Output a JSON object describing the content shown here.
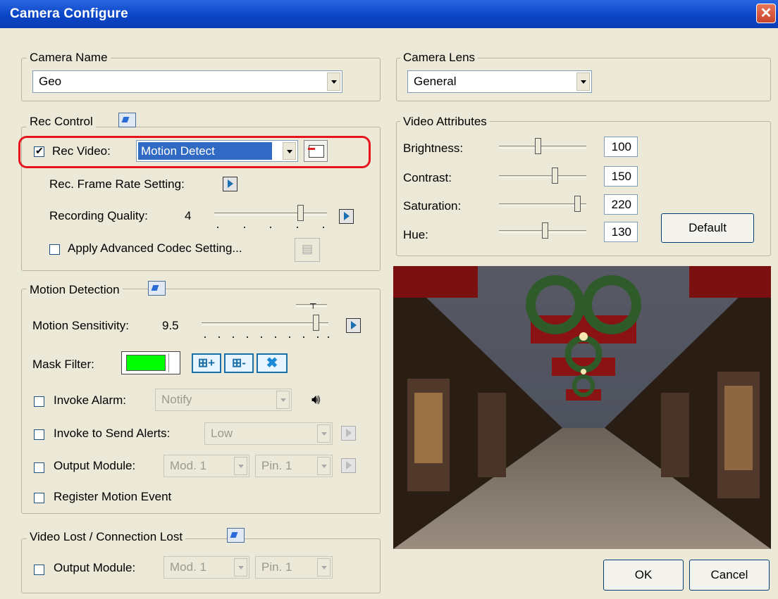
{
  "window": {
    "title": "Camera Configure"
  },
  "camera_name": {
    "legend": "Camera Name",
    "value": "Geo"
  },
  "camera_lens": {
    "legend": "Camera Lens",
    "value": "General"
  },
  "rec_control": {
    "legend": "Rec Control",
    "rec_video_label": "Rec Video:",
    "rec_video_checked": true,
    "rec_video_value": "Motion Detect",
    "frame_rate_label": "Rec. Frame Rate Setting:",
    "quality_label": "Recording Quality:",
    "quality_value": "4",
    "advanced_codec_label": "Apply Advanced Codec Setting..."
  },
  "video_attributes": {
    "legend": "Video Attributes",
    "rows": [
      {
        "label": "Brightness:",
        "value": "100"
      },
      {
        "label": "Contrast:",
        "value": "150"
      },
      {
        "label": "Saturation:",
        "value": "220"
      },
      {
        "label": "Hue:",
        "value": "130"
      }
    ],
    "default_label": "Default"
  },
  "motion_detection": {
    "legend": "Motion Detection",
    "sensitivity_label": "Motion Sensitivity:",
    "sensitivity_value": "9.5",
    "mask_filter_label": "Mask Filter:",
    "mask_color": "#00ff00",
    "invoke_alarm_label": "Invoke Alarm:",
    "invoke_alarm_value": "Notify",
    "send_alerts_label": "Invoke to Send Alerts:",
    "send_alerts_value": "Low",
    "output_module_label": "Output Module:",
    "module_value": "Mod. 1",
    "pin_value": "Pin. 1",
    "register_label": "Register Motion Event"
  },
  "video_lost": {
    "legend": "Video Lost / Connection Lost",
    "output_module_label": "Output Module:",
    "module_value": "Mod. 1",
    "pin_value": "Pin. 1"
  },
  "footer": {
    "ok_label": "OK",
    "cancel_label": "Cancel"
  },
  "colors": {
    "highlight": "#316ac5",
    "annotation": "#e8141e"
  }
}
